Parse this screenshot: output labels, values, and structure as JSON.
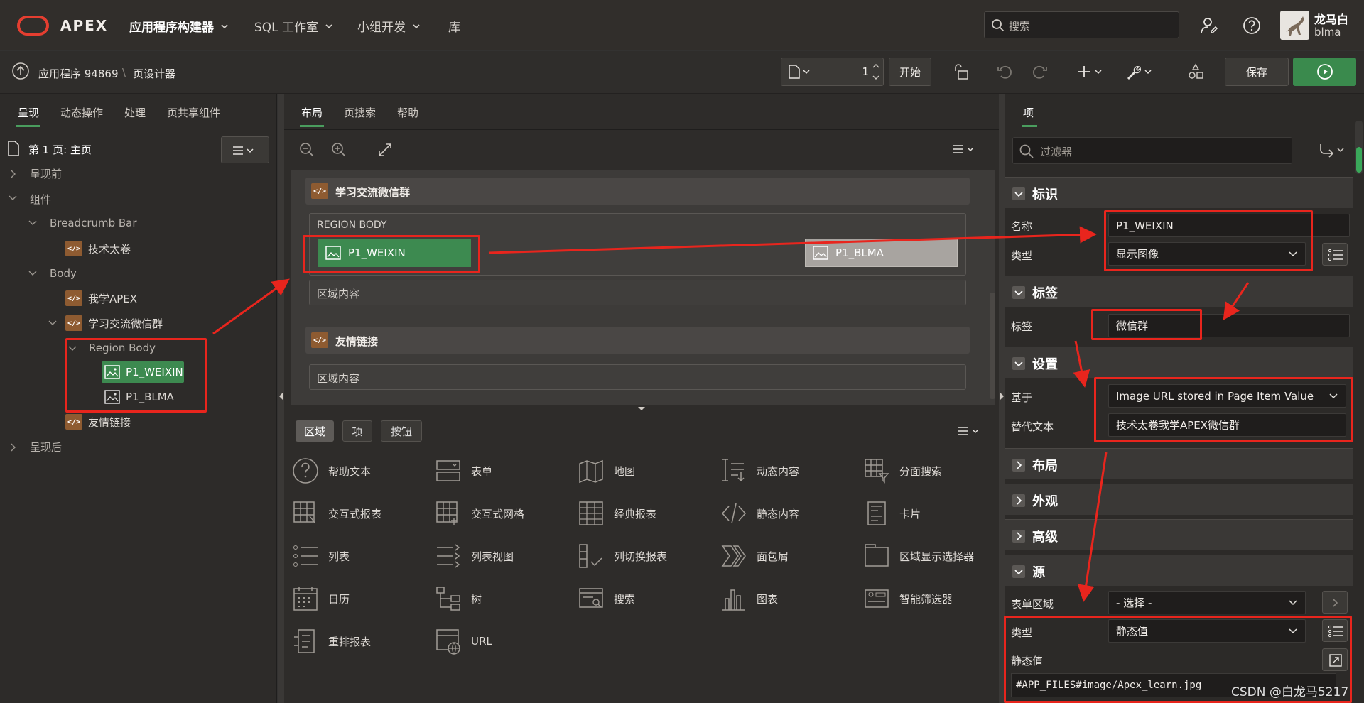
{
  "header": {
    "brand": "APEX",
    "nav": [
      "应用程序构建器",
      "SQL 工作室",
      "小组开发",
      "库"
    ],
    "search_placeholder": "搜索",
    "user_name": "龙马白",
    "user_id": "blma"
  },
  "toolbar": {
    "app_label": "应用程序 94869",
    "page_designer": "页设计器",
    "page_number": "1",
    "go_label": "开始",
    "save_label": "保存"
  },
  "left": {
    "tabs": [
      "呈现",
      "动态操作",
      "处理",
      "页共享组件"
    ],
    "page_title": "第 1 页: 主页",
    "tree": {
      "before": "呈现前",
      "components": "组件",
      "breadcrumb_bar": "Breadcrumb Bar",
      "jishu": "技术太卷",
      "body": "Body",
      "wo_xue": "我学APEX",
      "wechat_group": "学习交流微信群",
      "region_body": "Region Body",
      "p1_weixin": "P1_WEIXIN",
      "p1_blma": "P1_BLMA",
      "friend_links": "友情链接",
      "after": "呈现后"
    }
  },
  "middle": {
    "tabs": [
      "布局",
      "页搜索",
      "帮助"
    ],
    "region1_title": "学习交流微信群",
    "region_body_label": "REGION BODY",
    "item1": "P1_WEIXIN",
    "item2": "P1_BLMA",
    "region_content": "区域内容",
    "region2_title": "友情链接",
    "region2_content": "区域内容",
    "gallery_tabs": [
      "区域",
      "项",
      "按钮"
    ],
    "gallery": [
      {
        "label": "帮助文本",
        "icon": "help-icon"
      },
      {
        "label": "表单",
        "icon": "form-icon"
      },
      {
        "label": "地图",
        "icon": "map-icon"
      },
      {
        "label": "动态内容",
        "icon": "dynamic-content-icon"
      },
      {
        "label": "分面搜索",
        "icon": "faceted-search-icon"
      },
      {
        "label": "交互式报表",
        "icon": "interactive-report-icon"
      },
      {
        "label": "交互式网格",
        "icon": "interactive-grid-icon"
      },
      {
        "label": "经典报表",
        "icon": "classic-report-icon"
      },
      {
        "label": "静态内容",
        "icon": "static-content-icon"
      },
      {
        "label": "卡片",
        "icon": "cards-icon"
      },
      {
        "label": "列表",
        "icon": "list-icon"
      },
      {
        "label": "列表视图",
        "icon": "list-view-icon"
      },
      {
        "label": "列切换报表",
        "icon": "column-toggle-icon"
      },
      {
        "label": "面包屑",
        "icon": "breadcrumb-icon"
      },
      {
        "label": "区域显示选择器",
        "icon": "region-selector-icon"
      },
      {
        "label": "日历",
        "icon": "calendar-icon"
      },
      {
        "label": "树",
        "icon": "tree-icon"
      },
      {
        "label": "搜索",
        "icon": "search-region-icon"
      },
      {
        "label": "图表",
        "icon": "chart-icon"
      },
      {
        "label": "智能筛选器",
        "icon": "smart-filter-icon"
      },
      {
        "label": "重排报表",
        "icon": "reflow-report-icon"
      },
      {
        "label": "URL",
        "icon": "url-icon"
      }
    ]
  },
  "right": {
    "tab": "项",
    "filter_placeholder": "过滤器",
    "sections": {
      "identification": "标识",
      "label": "标签",
      "settings": "设置",
      "layout": "布局",
      "appearance": "外观",
      "advanced": "高级",
      "source": "源"
    },
    "fields": {
      "name_label": "名称",
      "name_value": "P1_WEIXIN",
      "type_label": "类型",
      "type_value": "显示图像",
      "label_label": "标签",
      "label_value": "微信群",
      "based_on_label": "基于",
      "based_on_value": "Image URL stored in Page Item Value",
      "alt_label": "替代文本",
      "alt_value": "技术太卷我学APEX微信群",
      "form_region_label": "表单区域",
      "form_region_value": "- 选择 -",
      "source_type_label": "类型",
      "source_type_value": "静态值",
      "static_value_label": "静态值",
      "static_value": "#APP_FILES#image/Apex_learn.jpg"
    }
  },
  "watermark": "CSDN @白龙马5217",
  "colors": {
    "accent_green": "#3d8a50",
    "annotation_red": "#e8251d",
    "region_brown": "#8e5b31"
  }
}
